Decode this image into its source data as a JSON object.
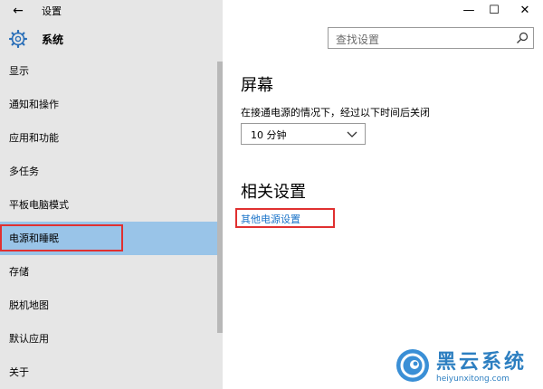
{
  "window": {
    "title": "设置",
    "back_icon": "←",
    "minimize_icon": "—",
    "maximize_icon": "☐",
    "close_icon": "✕"
  },
  "section": {
    "title": "系统",
    "icon": "gear-icon"
  },
  "search": {
    "placeholder": "查找设置",
    "icon": "search-icon"
  },
  "nav": {
    "items": [
      {
        "label": "显示"
      },
      {
        "label": "通知和操作"
      },
      {
        "label": "应用和功能"
      },
      {
        "label": "多任务"
      },
      {
        "label": "平板电脑模式"
      },
      {
        "label": "电源和睡眠",
        "selected": true
      },
      {
        "label": "存储"
      },
      {
        "label": "脱机地图"
      },
      {
        "label": "默认应用"
      },
      {
        "label": "关于"
      }
    ]
  },
  "content": {
    "screen_heading": "屏幕",
    "screen_description": "在接通电源的情况下，经过以下时间后关闭",
    "timeout_value": "10 分钟",
    "related_heading": "相关设置",
    "related_link": "其他电源设置"
  },
  "watermark": {
    "brand": "黑云系统",
    "url": "heiyunxitong.com"
  },
  "colors": {
    "selected_nav": "#99c4e8",
    "link": "#1a73c8",
    "highlight_outline": "#e03030",
    "brand": "#2d7fc1"
  }
}
